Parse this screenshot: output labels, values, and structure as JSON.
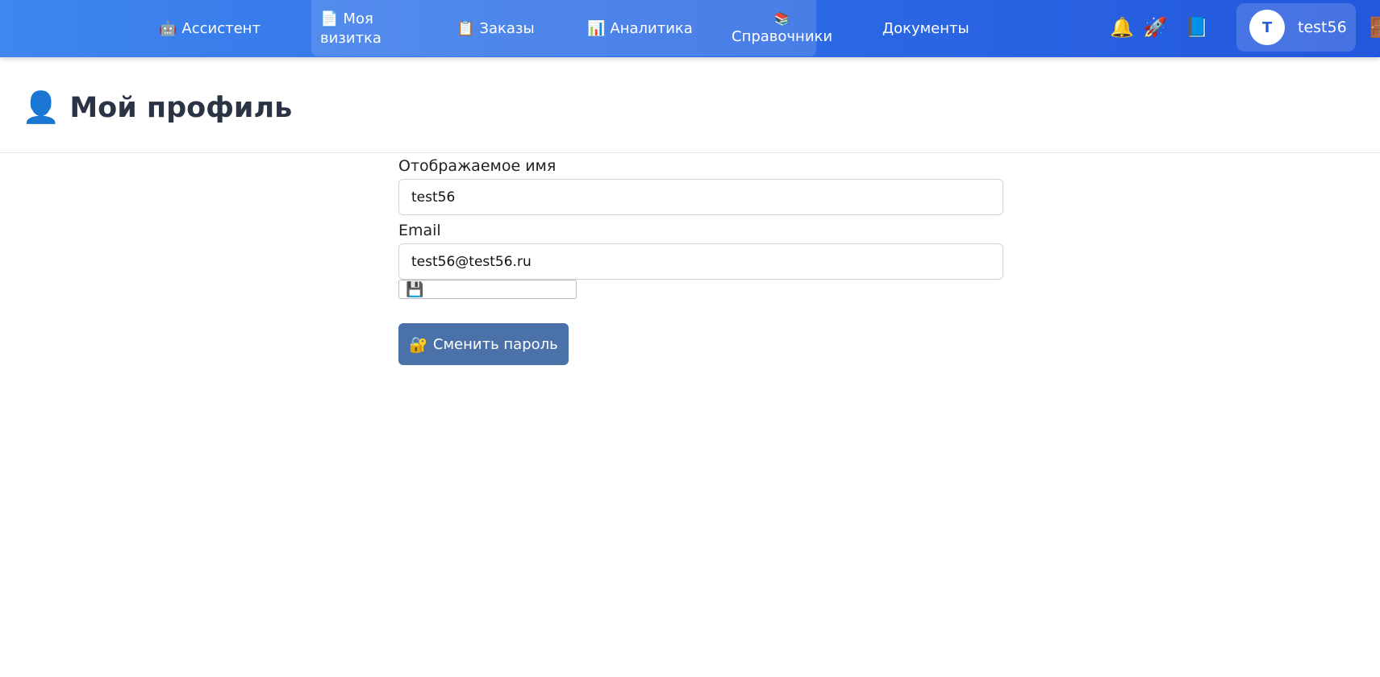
{
  "nav": {
    "items": [
      {
        "icon": "🤖",
        "label": "Ассистент"
      },
      {
        "icon": "📄",
        "label": "Моя",
        "label2": "визитка"
      },
      {
        "icon": "📋",
        "label": "Заказы"
      },
      {
        "icon": "📊",
        "label": "Аналитика"
      },
      {
        "icon": "📚",
        "label": "Справочники"
      },
      {
        "label": "Документы"
      }
    ],
    "actions": {
      "bell_icon": "🔔",
      "rocket_icon": "🚀",
      "book_icon": "📘",
      "door_icon": "🚪"
    },
    "user": {
      "initial": "T",
      "name": "test56"
    }
  },
  "page": {
    "title_icon": "👤",
    "title": "Мой профиль"
  },
  "form": {
    "display_name_label": "Отображаемое имя",
    "display_name_value": "test56",
    "email_label": "Email",
    "email_value": "test56@test56.ru",
    "save_icon": "💾",
    "change_password_icon": "🔐",
    "change_password_label": "Сменить пароль"
  },
  "colors": {
    "nav_gradient_start": "#3f86ef",
    "nav_gradient_end": "#2357dd",
    "password_button": "#4a72a8"
  }
}
